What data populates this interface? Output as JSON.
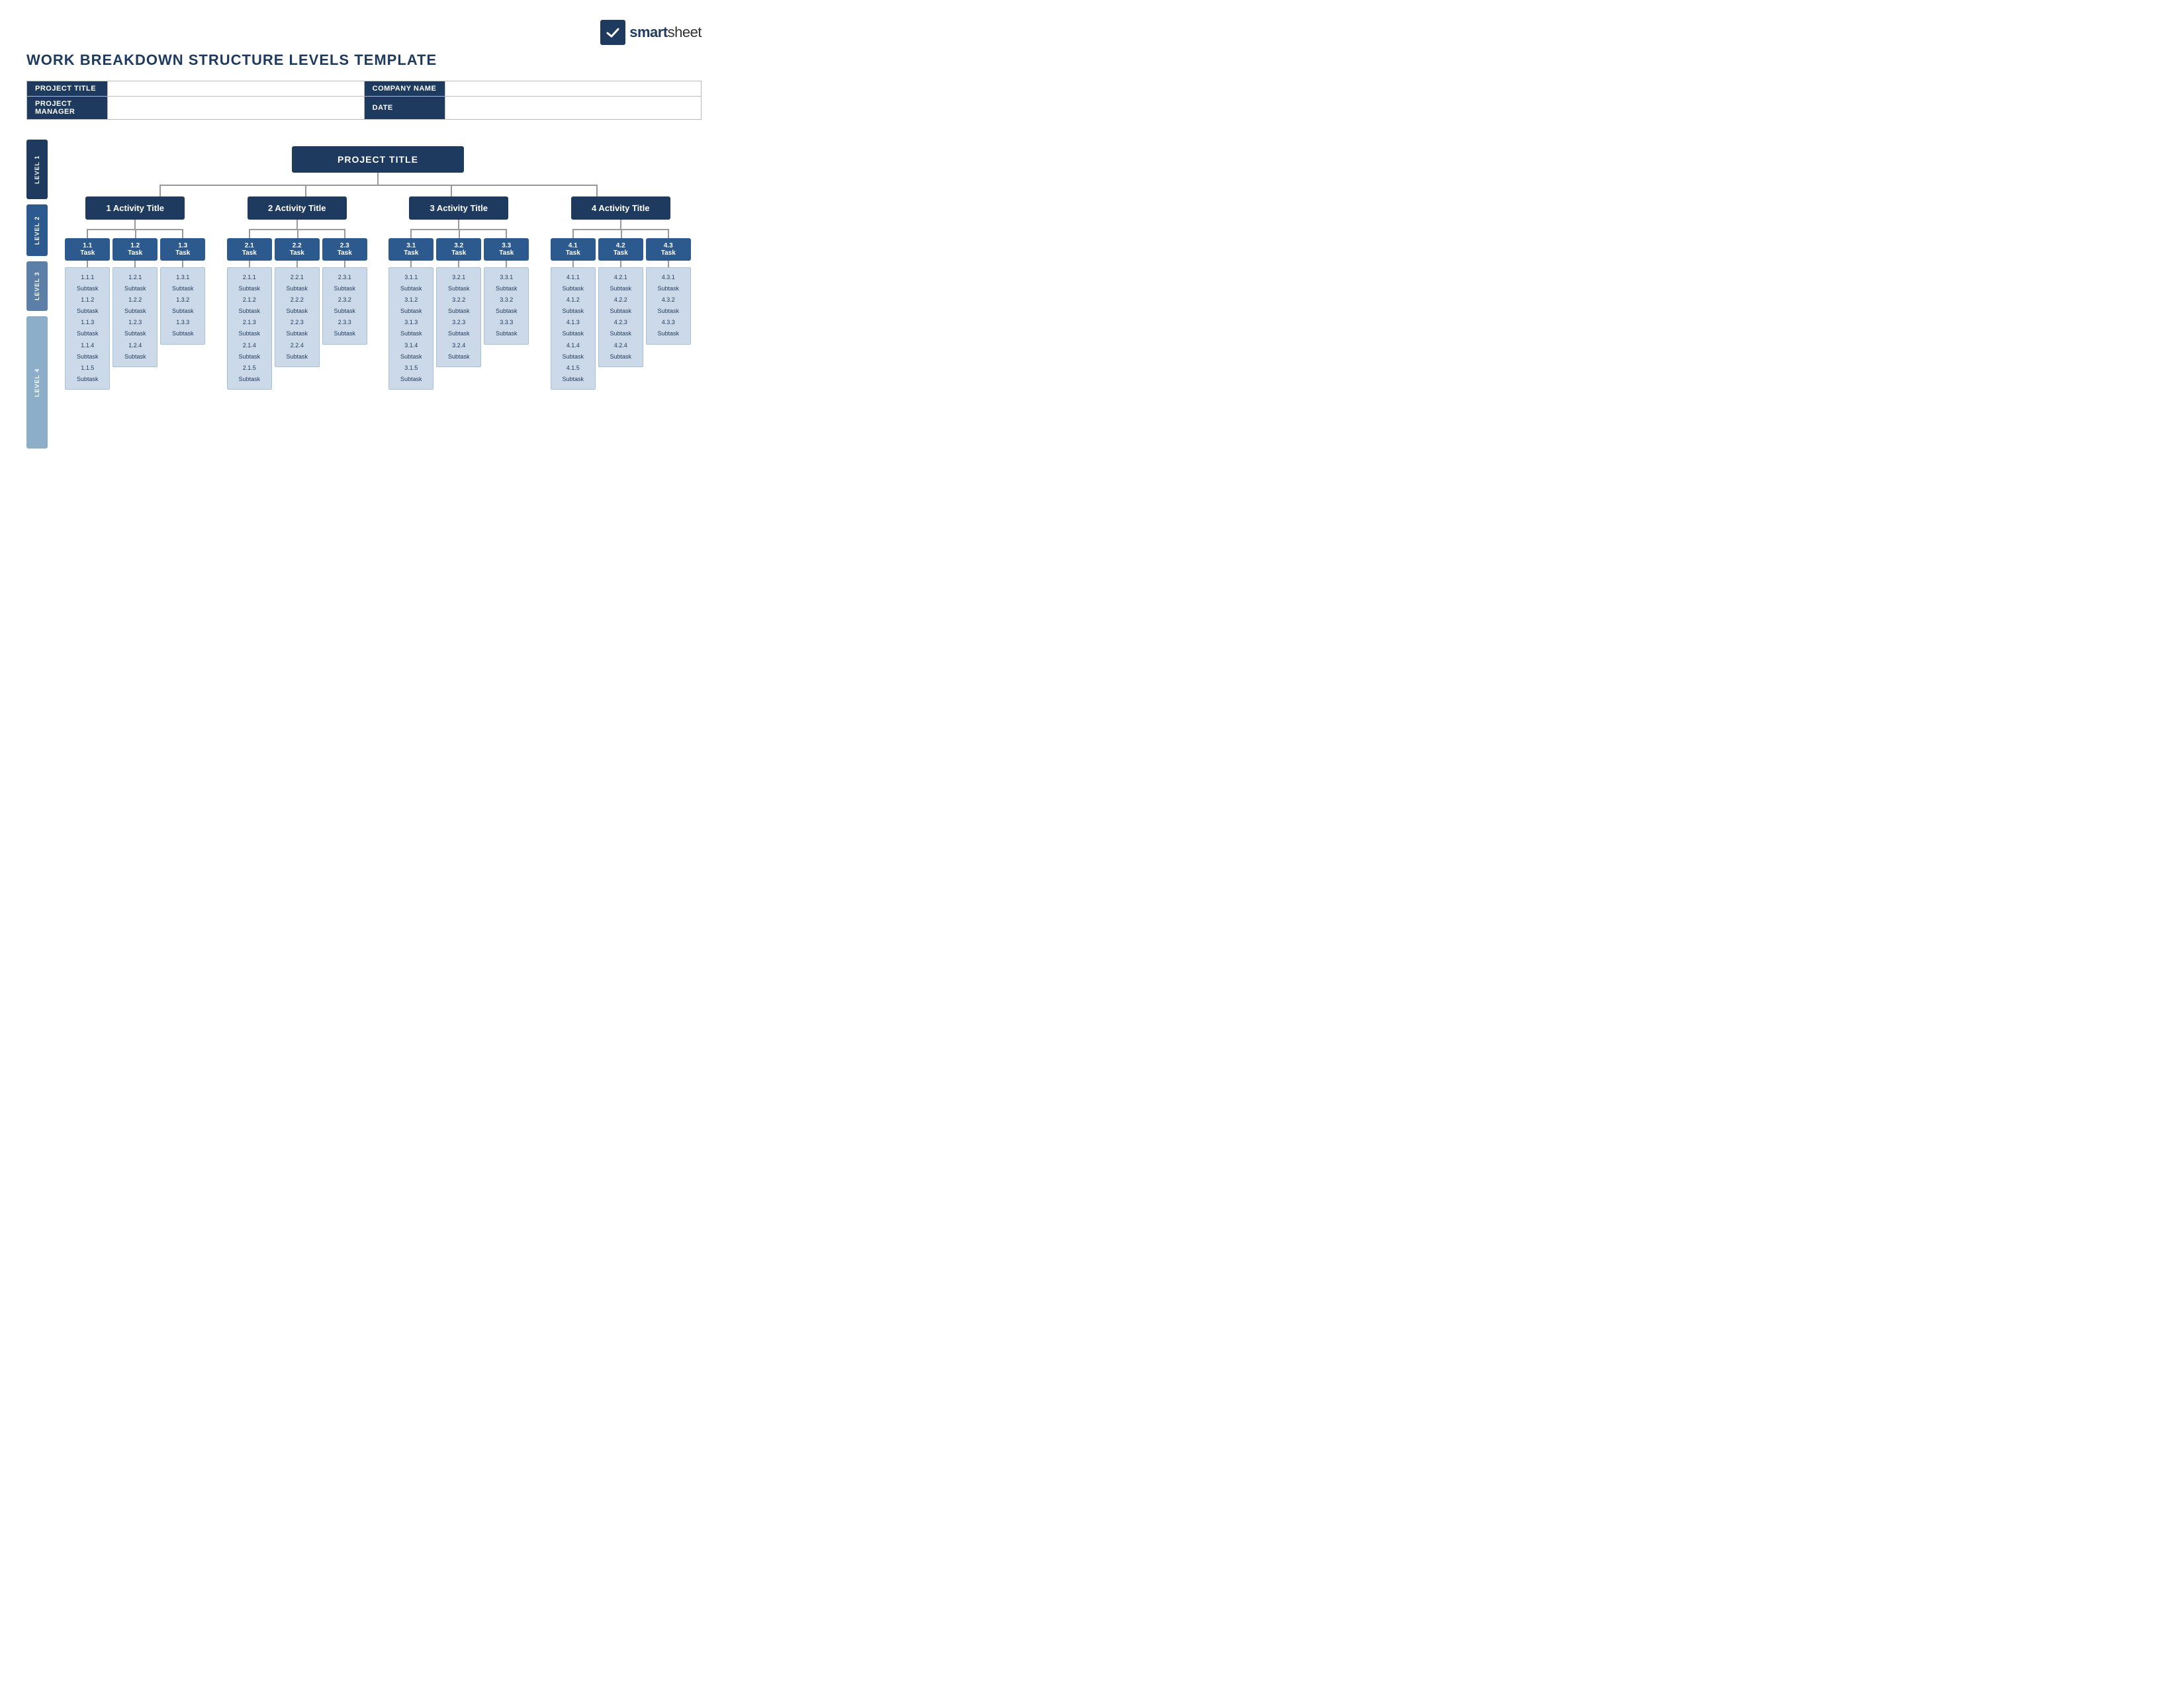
{
  "logo": {
    "brand": "smartsheet",
    "brand_bold": "smart",
    "brand_light": "sheet"
  },
  "page_title": "WORK BREAKDOWN STRUCTURE LEVELS TEMPLATE",
  "info_fields": {
    "project_title_label": "PROJECT TITLE",
    "project_title_value": "",
    "company_name_label": "COMPANY NAME",
    "company_name_value": "",
    "project_manager_label": "PROJECT MANAGER",
    "project_manager_value": "",
    "date_label": "DATE",
    "date_value": ""
  },
  "levels": {
    "level1": "LEVEL 1",
    "level2": "LEVEL 2",
    "level3": "LEVEL 3",
    "level4": "LEVEL 4"
  },
  "project_title_node": "PROJECT TITLE",
  "activities": [
    {
      "id": "act1",
      "label": "1 Activity Title",
      "tasks": [
        {
          "id": "t1_1",
          "label": "1.1\nTask",
          "subtasks": [
            "1.1.1\nSubtask",
            "1.1.2\nSubtask",
            "1.1.3\nSubtask",
            "1.1.4\nSubtask",
            "1.1.5\nSubtask"
          ]
        },
        {
          "id": "t1_2",
          "label": "1.2\nTask",
          "subtasks": [
            "1.2.1\nSubtask",
            "1.2.2\nSubtask",
            "1.2.3\nSubtask",
            "1.2.4\nSubtask"
          ]
        },
        {
          "id": "t1_3",
          "label": "1.3\nTask",
          "subtasks": [
            "1.3.1\nSubtask",
            "1.3.2\nSubtask",
            "1.3.3\nSubtask"
          ]
        }
      ]
    },
    {
      "id": "act2",
      "label": "2 Activity Title",
      "tasks": [
        {
          "id": "t2_1",
          "label": "2.1\nTask",
          "subtasks": [
            "2.1.1\nSubtask",
            "2.1.2\nSubtask",
            "2.1.3\nSubtask",
            "2.1.4\nSubtask",
            "2.1.5\nSubtask"
          ]
        },
        {
          "id": "t2_2",
          "label": "2.2\nTask",
          "subtasks": [
            "2.2.1\nSubtask",
            "2.2.2\nSubtask",
            "2.2.3\nSubtask",
            "2.2.4\nSubtask"
          ]
        },
        {
          "id": "t2_3",
          "label": "2.3\nTask",
          "subtasks": [
            "2.3.1\nSubtask",
            "2.3.2\nSubtask",
            "2.3.3\nSubtask"
          ]
        }
      ]
    },
    {
      "id": "act3",
      "label": "3 Activity Title",
      "tasks": [
        {
          "id": "t3_1",
          "label": "3.1\nTask",
          "subtasks": [
            "3.1.1\nSubtask",
            "3.1.2\nSubtask",
            "3.1.3\nSubtask",
            "3.1.4\nSubtask",
            "3.1.5\nSubtask"
          ]
        },
        {
          "id": "t3_2",
          "label": "3.2\nTask",
          "subtasks": [
            "3.2.1\nSubtask",
            "3.2.2\nSubtask",
            "3.2.3\nSubtask",
            "3.2.4\nSubtask"
          ]
        },
        {
          "id": "t3_3",
          "label": "3.3\nTask",
          "subtasks": [
            "3.3.1\nSubtask",
            "3.3.2\nSubtask",
            "3.3.3\nSubtask"
          ]
        }
      ]
    },
    {
      "id": "act4",
      "label": "4 Activity Title",
      "tasks": [
        {
          "id": "t4_1",
          "label": "4.1\nTask",
          "subtasks": [
            "4.1.1\nSubtask",
            "4.1.2\nSubtask",
            "4.1.3\nSubtask",
            "4.1.4\nSubtask",
            "4.1.5\nSubtask"
          ]
        },
        {
          "id": "t4_2",
          "label": "4.2\nTask",
          "subtasks": [
            "4.2.1\nSubtask",
            "4.2.2\nSubtask",
            "4.2.3\nSubtask",
            "4.2.4\nSubtask"
          ]
        },
        {
          "id": "t4_3",
          "label": "4.3\nTask",
          "subtasks": [
            "4.3.1\nSubtask",
            "4.3.2\nSubtask",
            "4.3.3\nSubtask"
          ]
        }
      ]
    }
  ],
  "colors": {
    "level1_bg": "#1e3a5f",
    "level2_bg": "#1e3a5f",
    "level3_bg": "#2d5a8e",
    "level4_bg": "#ccd9e8",
    "label1_bg": "#1e3a5f",
    "label2_bg": "#2d5a8e",
    "label3_bg": "#5b7fa6",
    "label4_bg": "#8daec8",
    "connector": "#999999",
    "text_light": "#ffffff",
    "text_dark": "#1e3a5f",
    "border": "#bbbbbb"
  }
}
